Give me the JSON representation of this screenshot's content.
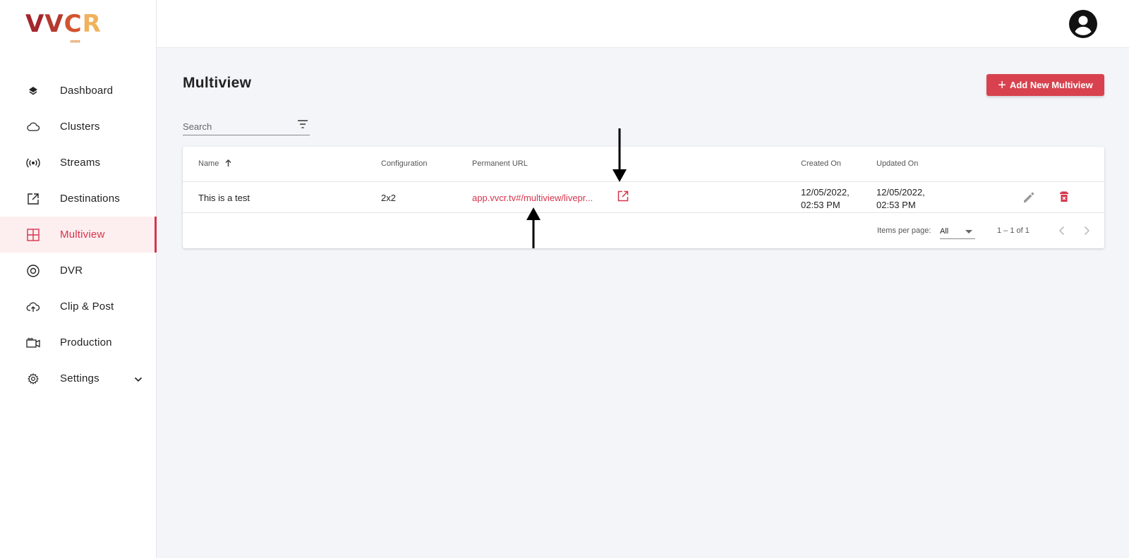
{
  "app": {
    "logo_letters": [
      "V",
      "V",
      "C",
      "R"
    ],
    "logo_colors": [
      "#a3262c",
      "#b53a2e",
      "#d1542f",
      "#f0b25c"
    ],
    "logo_arrows": "›››››››"
  },
  "sidebar": {
    "items": [
      {
        "label": "Dashboard",
        "icon": "layers-icon"
      },
      {
        "label": "Clusters",
        "icon": "cloud-icon"
      },
      {
        "label": "Streams",
        "icon": "broadcast-icon"
      },
      {
        "label": "Destinations",
        "icon": "external-link-icon"
      },
      {
        "label": "Multiview",
        "icon": "grid-icon",
        "active": true
      },
      {
        "label": "DVR",
        "icon": "record-icon"
      },
      {
        "label": "Clip & Post",
        "icon": "cloud-upload-icon"
      },
      {
        "label": "Production",
        "icon": "video-camera-icon"
      },
      {
        "label": "Settings",
        "icon": "gear-icon",
        "expandable": true
      }
    ]
  },
  "header": {
    "title": "Multiview",
    "add_button_label": "Add New Multiview"
  },
  "search": {
    "placeholder": "Search"
  },
  "table": {
    "columns": {
      "name": "Name",
      "configuration": "Configuration",
      "permanent_url": "Permanent URL",
      "created_on": "Created On",
      "updated_on": "Updated On"
    },
    "rows": [
      {
        "name": "This is a test",
        "configuration": "2x2",
        "permanent_url": "app.vvcr.tv#/multiview/livepr...",
        "created_on_date": "12/05/2022,",
        "created_on_time": "02:53 PM",
        "updated_on_date": "12/05/2022,",
        "updated_on_time": "02:53 PM"
      }
    ]
  },
  "pagination": {
    "items_per_page_label": "Items per page:",
    "items_per_page_value": "All",
    "range": "1 – 1 of 1"
  },
  "colors": {
    "accent": "#d6344b",
    "button": "#d8424f",
    "active_bg": "#fdeef0"
  }
}
